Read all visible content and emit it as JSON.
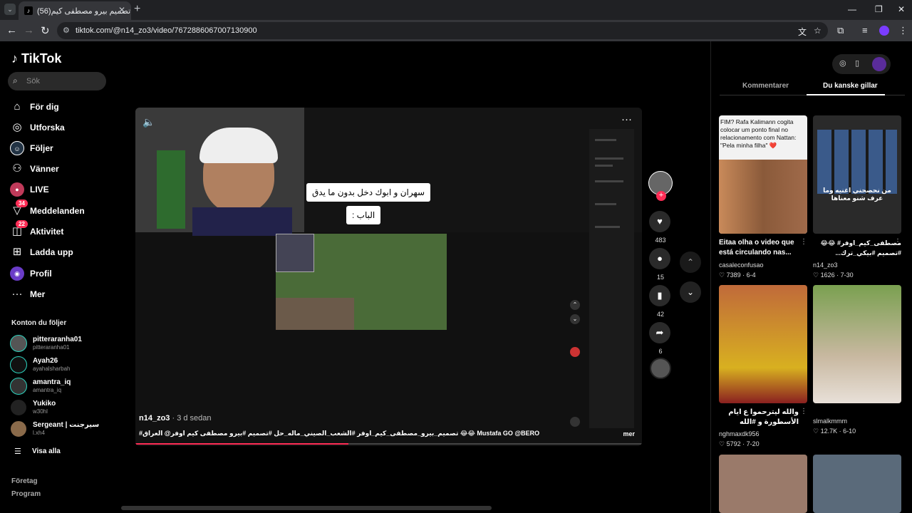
{
  "browser": {
    "tab_title": "(56)تصميم بيرو مصطفى كيم...",
    "tab_favicon": "tiktok-icon",
    "url": "tiktok.com/@n14_zo3/video/7672886067007130900"
  },
  "sidebar": {
    "logo": "TikTok",
    "search_placeholder": "Sök",
    "nav": [
      {
        "label": "För dig",
        "icon": "home-icon"
      },
      {
        "label": "Utforska",
        "icon": "compass-icon"
      },
      {
        "label": "Följer",
        "icon": "following-icon"
      },
      {
        "label": "Vänner",
        "icon": "friends-icon"
      },
      {
        "label": "LIVE",
        "icon": "live-icon"
      },
      {
        "label": "Meddelanden",
        "icon": "inbox-icon",
        "badge": "34"
      },
      {
        "label": "Aktivitet",
        "icon": "activity-icon",
        "badge": "22"
      },
      {
        "label": "Ladda upp",
        "icon": "upload-icon"
      },
      {
        "label": "Profil",
        "icon": "profile-icon"
      },
      {
        "label": "Mer",
        "icon": "more-icon"
      }
    ],
    "following_header": "Konton du följer",
    "accounts": [
      {
        "name": "pitteraranha01",
        "handle": "pitteraranha01"
      },
      {
        "name": "Ayah26",
        "handle": "ayahalsharbah"
      },
      {
        "name": "amantra_iq",
        "handle": "amantra_iq"
      },
      {
        "name": "Yukiko",
        "handle": "w30hl"
      },
      {
        "name": "Sergeant | سيرجنت",
        "handle": "l.xh4"
      }
    ],
    "see_all": "Visa alla",
    "footer": [
      "Företag",
      "Program"
    ]
  },
  "video": {
    "overlay_line1": "سهران و ابوك دخل بدون ما يدق",
    "overlay_line2": "الباب :",
    "author": "n14_zo3",
    "time": "· 3 d sedan",
    "description": "#تصميم_بيرو_مصطفى_كيم_اوفر #الشعب_الصيني_ماله_حل #تصميم #بيرو مصطفى كيم اوفر@ العراق 😂😂 Mustafa GO @BERO",
    "more": "mer",
    "progress": 0.42
  },
  "actions": {
    "likes": "483",
    "comments": "15",
    "saves": "42",
    "shares": "6"
  },
  "right_panel": {
    "tabs": [
      "Kommentarer",
      "Du kanske gillar"
    ],
    "active_tab": 1,
    "cards": [
      {
        "thumb_text": "FIM? Rafa Kalimann cogita colocar um ponto final no relacionamento com Nattan: \"Pela minha filha\" ❤️",
        "title": "Eitaa olha o video que está circulando nas...",
        "user": "casaleconfusao",
        "likes": "7389",
        "date": "6-4"
      },
      {
        "thumb_text": "من نحصحني اغنيه وما عرف شنو معناها",
        "title": "مصطفى_كيم_اوفر# 😂😂 #تصميم #بيكي_ترك...",
        "user": "n14_zo3",
        "likes": "1626",
        "date": "7-30"
      },
      {
        "thumb_text": "",
        "title": "والله ليترحموا ع ايام الأسطورة و #الله",
        "user": "nghmaxdk956",
        "likes": "5792",
        "date": "7-20"
      },
      {
        "thumb_text": "",
        "title": "",
        "user": "slmalkmmm",
        "likes": "12.7K",
        "date": "6-10"
      }
    ]
  }
}
